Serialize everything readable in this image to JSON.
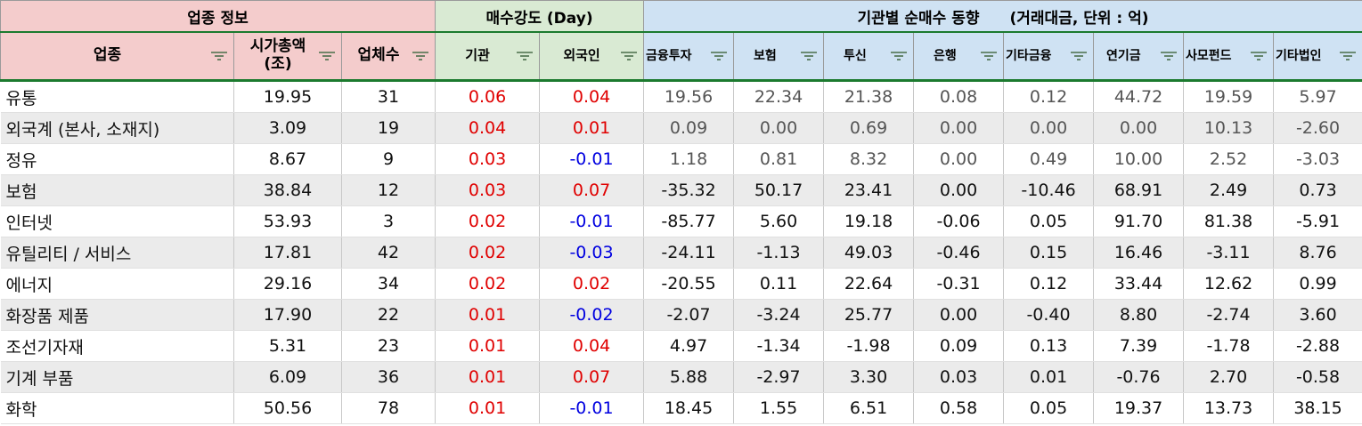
{
  "groups": {
    "sector_info": "업종 정보",
    "buy_strength": "매수강도 (Day)",
    "inst_flow": "기관별 순매수 동향",
    "inst_flow_unit": "(거래대금, 단위 : 억)"
  },
  "headers": {
    "sector": "업종",
    "mktcap_line1": "시가총액",
    "mktcap_line2": "(조)",
    "companies": "업체수",
    "institution": "기관",
    "foreign": "외국인",
    "fin_invest": "금융투자",
    "insurance": "보험",
    "trust": "투신",
    "bank": "은행",
    "other_fin": "기타금융",
    "pension": "연기금",
    "private_fund": "사모펀드",
    "other_corp": "기타법인"
  },
  "filter_icon": "filter-icon",
  "colors": {
    "positive": "#e00000",
    "negative": "#0000e0",
    "header_pink": "#f4cccc",
    "header_green": "#d9ead3",
    "header_blue": "#cfe2f3"
  },
  "rows": [
    {
      "sector": "유통",
      "mktcap": "19.95",
      "companies": "31",
      "institution": "0.06",
      "foreign": "0.04",
      "fin_invest": "19.56",
      "insurance": "22.34",
      "trust": "21.38",
      "bank": "0.08",
      "other_fin": "0.12",
      "pension": "44.72",
      "private_fund": "19.59",
      "other_corp": "5.97"
    },
    {
      "sector": "외국계 (본사, 소재지)",
      "mktcap": "3.09",
      "companies": "19",
      "institution": "0.04",
      "foreign": "0.01",
      "fin_invest": "0.09",
      "insurance": "0.00",
      "trust": "0.69",
      "bank": "0.00",
      "other_fin": "0.00",
      "pension": "0.00",
      "private_fund": "10.13",
      "other_corp": "-2.60"
    },
    {
      "sector": "정유",
      "mktcap": "8.67",
      "companies": "9",
      "institution": "0.03",
      "foreign": "-0.01",
      "fin_invest": "1.18",
      "insurance": "0.81",
      "trust": "8.32",
      "bank": "0.00",
      "other_fin": "0.49",
      "pension": "10.00",
      "private_fund": "2.52",
      "other_corp": "-3.03"
    },
    {
      "sector": "보험",
      "mktcap": "38.84",
      "companies": "12",
      "institution": "0.03",
      "foreign": "0.07",
      "fin_invest": "-35.32",
      "insurance": "50.17",
      "trust": "23.41",
      "bank": "0.00",
      "other_fin": "-10.46",
      "pension": "68.91",
      "private_fund": "2.49",
      "other_corp": "0.73"
    },
    {
      "sector": "인터넷",
      "mktcap": "53.93",
      "companies": "3",
      "institution": "0.02",
      "foreign": "-0.01",
      "fin_invest": "-85.77",
      "insurance": "5.60",
      "trust": "19.18",
      "bank": "-0.06",
      "other_fin": "0.05",
      "pension": "91.70",
      "private_fund": "81.38",
      "other_corp": "-5.91"
    },
    {
      "sector": "유틸리티 / 서비스",
      "mktcap": "17.81",
      "companies": "42",
      "institution": "0.02",
      "foreign": "-0.03",
      "fin_invest": "-24.11",
      "insurance": "-1.13",
      "trust": "49.03",
      "bank": "-0.46",
      "other_fin": "0.15",
      "pension": "16.46",
      "private_fund": "-3.11",
      "other_corp": "8.76"
    },
    {
      "sector": "에너지",
      "mktcap": "29.16",
      "companies": "34",
      "institution": "0.02",
      "foreign": "0.02",
      "fin_invest": "-20.55",
      "insurance": "0.11",
      "trust": "22.64",
      "bank": "-0.31",
      "other_fin": "0.12",
      "pension": "33.44",
      "private_fund": "12.62",
      "other_corp": "0.99"
    },
    {
      "sector": "화장품 제품",
      "mktcap": "17.90",
      "companies": "22",
      "institution": "0.01",
      "foreign": "-0.02",
      "fin_invest": "-2.07",
      "insurance": "-3.24",
      "trust": "25.77",
      "bank": "0.00",
      "other_fin": "-0.40",
      "pension": "8.80",
      "private_fund": "-2.74",
      "other_corp": "3.60"
    },
    {
      "sector": "조선기자재",
      "mktcap": "5.31",
      "companies": "23",
      "institution": "0.01",
      "foreign": "0.04",
      "fin_invest": "4.97",
      "insurance": "-1.34",
      "trust": "-1.98",
      "bank": "0.09",
      "other_fin": "0.13",
      "pension": "7.39",
      "private_fund": "-1.78",
      "other_corp": "-2.88"
    },
    {
      "sector": "기계 부품",
      "mktcap": "6.09",
      "companies": "36",
      "institution": "0.01",
      "foreign": "0.07",
      "fin_invest": "5.88",
      "insurance": "-2.97",
      "trust": "3.30",
      "bank": "0.03",
      "other_fin": "0.01",
      "pension": "-0.76",
      "private_fund": "2.70",
      "other_corp": "-0.58"
    },
    {
      "sector": "화학",
      "mktcap": "50.56",
      "companies": "78",
      "institution": "0.01",
      "foreign": "-0.01",
      "fin_invest": "18.45",
      "insurance": "1.55",
      "trust": "6.51",
      "bank": "0.58",
      "other_fin": "0.05",
      "pension": "19.37",
      "private_fund": "13.73",
      "other_corp": "38.15"
    }
  ]
}
